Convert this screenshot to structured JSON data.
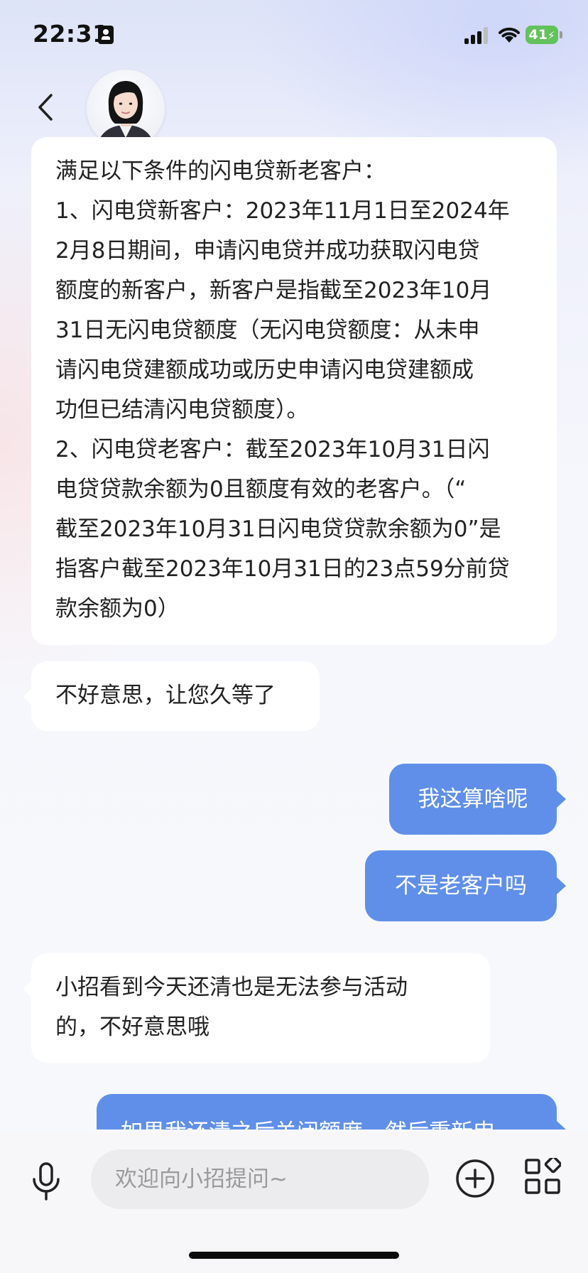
{
  "status_bar": {
    "time": "22:31",
    "battery": "41"
  },
  "header": {
    "back_icon": "chevron-left-icon",
    "avatar": "assistant-avatar"
  },
  "messages": {
    "m1": {
      "lines": [
        "满足以下条件的闪电贷新老客户：",
        "1、闪电贷新客户：2023年11月1日至2024年",
        "2月8日期间，申请闪电贷并成功获取闪电贷",
        "额度的新客户，新客户是指截至2023年10月",
        "31日无闪电贷额度（无闪电贷额度：从未申",
        "请闪电贷建额成功或历史申请闪电贷建额成",
        "功但已结清闪电贷额度）。",
        "2、闪电贷老客户：截至2023年10月31日闪",
        "电贷贷款余额为0且额度有效的老客户。（“",
        "截至2023年10月31日闪电贷贷款余额为0”是",
        "指客户截至2023年10月31日的23点59分前贷",
        "款余额为0）"
      ]
    },
    "m2": {
      "text": "不好意思，让您久等了"
    },
    "m3": {
      "text": "我这算啥呢"
    },
    "m4": {
      "text": "不是老客户吗"
    },
    "m5": {
      "line1": "小招看到今天还清也是无法参与活动",
      "line2": "的，不好意思哦"
    },
    "m6": {
      "text": "如果我还清之后关闭额度，然后重新申"
    }
  },
  "input": {
    "placeholder": "欢迎向小招提问~"
  },
  "colors": {
    "user_bubble": "#5f8fe9",
    "bot_bubble": "#ffffff",
    "battery": "#62c25b"
  }
}
